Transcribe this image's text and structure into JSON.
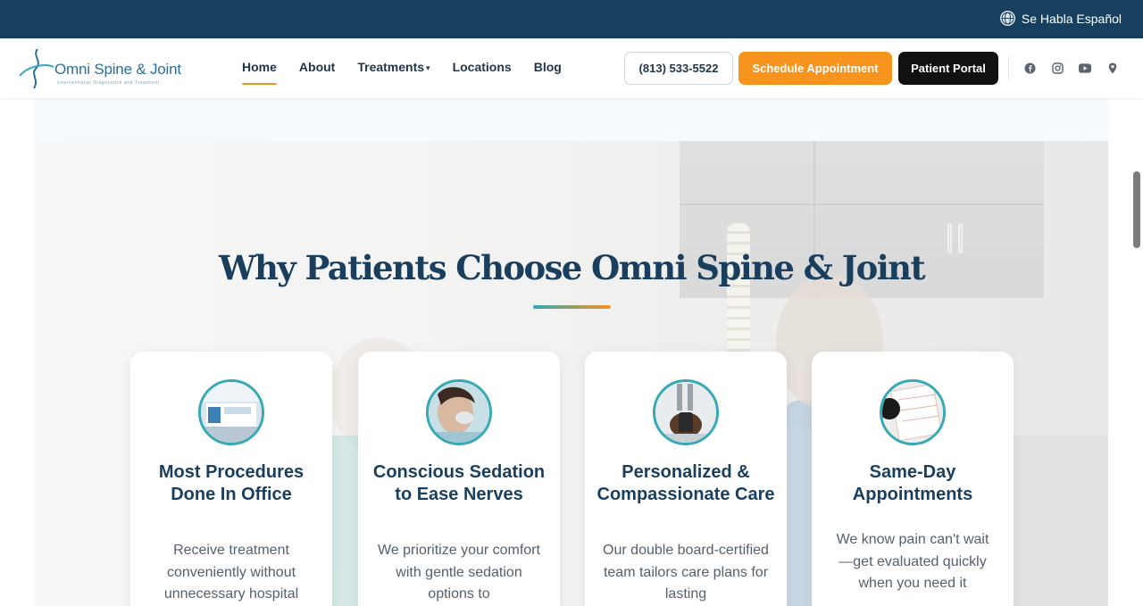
{
  "topbar": {
    "language_label": "Se Habla Español"
  },
  "header": {
    "logo_text": "Omni Spine & Joint",
    "logo_tagline": "Interventional Diagnostics and Treatment",
    "nav": [
      {
        "label": "Home",
        "active": true
      },
      {
        "label": "About"
      },
      {
        "label": "Treatments",
        "caret": "▾"
      },
      {
        "label": "Locations"
      },
      {
        "label": "Blog"
      }
    ],
    "phone_label": "(813) 533-5522",
    "schedule_label": "Schedule Appointment",
    "portal_label": "Patient Portal",
    "social": [
      "facebook-icon",
      "instagram-icon",
      "youtube-icon",
      "location-pin-icon"
    ]
  },
  "section": {
    "title": "Why Patients Choose Omni Spine & Joint"
  },
  "cards": [
    {
      "title": "Most Procedures Done In Office",
      "text": "Receive treatment conveniently without unnecessary hospital"
    },
    {
      "title": "Conscious Sedation to Ease Nerves",
      "text": "We prioritize your comfort with gentle sedation options to"
    },
    {
      "title": "Personalized & Compassionate Care",
      "text": "Our double board-certified team tailors care plans for lasting"
    },
    {
      "title": "Same-Day Appointments",
      "text": "We know pain can't wait—get evaluated quickly when you need it"
    }
  ],
  "colors": {
    "topbar": "#17405f",
    "accent_orange": "#f7941d",
    "accent_teal": "#37a9b5",
    "heading_navy": "#1a3f5e"
  }
}
